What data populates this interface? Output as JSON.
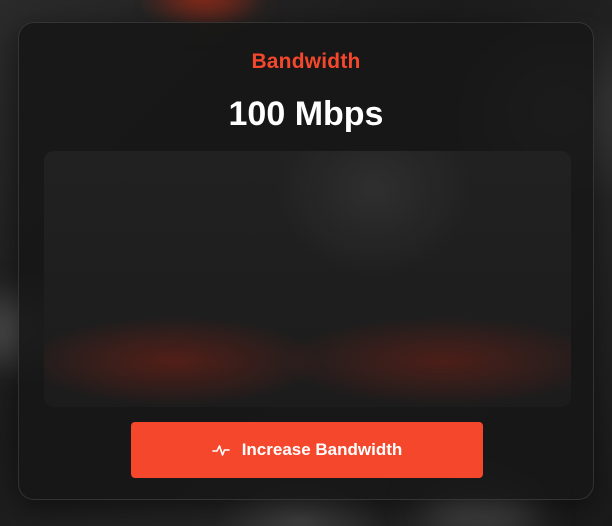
{
  "card": {
    "title": "Bandwidth",
    "value": "100 Mbps",
    "button_label": "Increase Bandwidth",
    "button_icon": "activity-icon"
  },
  "colors": {
    "accent": "#f4472b",
    "card_background": "#161616",
    "text": "#ffffff"
  }
}
